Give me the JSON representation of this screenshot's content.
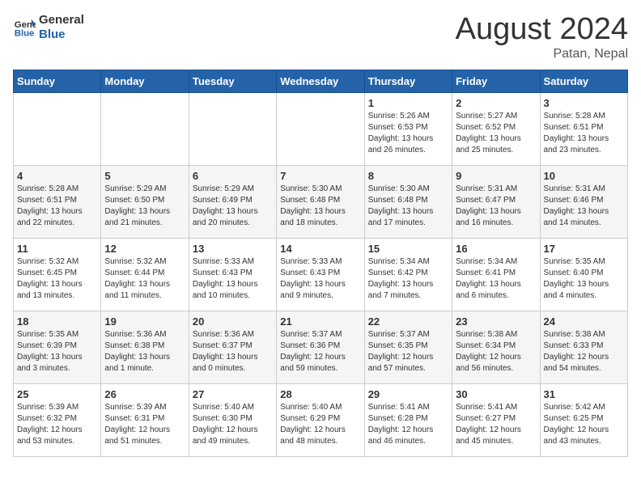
{
  "header": {
    "logo_general": "General",
    "logo_blue": "Blue",
    "main_title": "August 2024",
    "subtitle": "Patan, Nepal"
  },
  "days_of_week": [
    "Sunday",
    "Monday",
    "Tuesday",
    "Wednesday",
    "Thursday",
    "Friday",
    "Saturday"
  ],
  "weeks": [
    [
      {
        "day": "",
        "sunrise": "",
        "sunset": "",
        "daylight": ""
      },
      {
        "day": "",
        "sunrise": "",
        "sunset": "",
        "daylight": ""
      },
      {
        "day": "",
        "sunrise": "",
        "sunset": "",
        "daylight": ""
      },
      {
        "day": "",
        "sunrise": "",
        "sunset": "",
        "daylight": ""
      },
      {
        "day": "1",
        "sunrise": "Sunrise: 5:26 AM",
        "sunset": "Sunset: 6:53 PM",
        "daylight": "Daylight: 13 hours and 26 minutes."
      },
      {
        "day": "2",
        "sunrise": "Sunrise: 5:27 AM",
        "sunset": "Sunset: 6:52 PM",
        "daylight": "Daylight: 13 hours and 25 minutes."
      },
      {
        "day": "3",
        "sunrise": "Sunrise: 5:28 AM",
        "sunset": "Sunset: 6:51 PM",
        "daylight": "Daylight: 13 hours and 23 minutes."
      }
    ],
    [
      {
        "day": "4",
        "sunrise": "Sunrise: 5:28 AM",
        "sunset": "Sunset: 6:51 PM",
        "daylight": "Daylight: 13 hours and 22 minutes."
      },
      {
        "day": "5",
        "sunrise": "Sunrise: 5:29 AM",
        "sunset": "Sunset: 6:50 PM",
        "daylight": "Daylight: 13 hours and 21 minutes."
      },
      {
        "day": "6",
        "sunrise": "Sunrise: 5:29 AM",
        "sunset": "Sunset: 6:49 PM",
        "daylight": "Daylight: 13 hours and 20 minutes."
      },
      {
        "day": "7",
        "sunrise": "Sunrise: 5:30 AM",
        "sunset": "Sunset: 6:48 PM",
        "daylight": "Daylight: 13 hours and 18 minutes."
      },
      {
        "day": "8",
        "sunrise": "Sunrise: 5:30 AM",
        "sunset": "Sunset: 6:48 PM",
        "daylight": "Daylight: 13 hours and 17 minutes."
      },
      {
        "day": "9",
        "sunrise": "Sunrise: 5:31 AM",
        "sunset": "Sunset: 6:47 PM",
        "daylight": "Daylight: 13 hours and 16 minutes."
      },
      {
        "day": "10",
        "sunrise": "Sunrise: 5:31 AM",
        "sunset": "Sunset: 6:46 PM",
        "daylight": "Daylight: 13 hours and 14 minutes."
      }
    ],
    [
      {
        "day": "11",
        "sunrise": "Sunrise: 5:32 AM",
        "sunset": "Sunset: 6:45 PM",
        "daylight": "Daylight: 13 hours and 13 minutes."
      },
      {
        "day": "12",
        "sunrise": "Sunrise: 5:32 AM",
        "sunset": "Sunset: 6:44 PM",
        "daylight": "Daylight: 13 hours and 11 minutes."
      },
      {
        "day": "13",
        "sunrise": "Sunrise: 5:33 AM",
        "sunset": "Sunset: 6:43 PM",
        "daylight": "Daylight: 13 hours and 10 minutes."
      },
      {
        "day": "14",
        "sunrise": "Sunrise: 5:33 AM",
        "sunset": "Sunset: 6:43 PM",
        "daylight": "Daylight: 13 hours and 9 minutes."
      },
      {
        "day": "15",
        "sunrise": "Sunrise: 5:34 AM",
        "sunset": "Sunset: 6:42 PM",
        "daylight": "Daylight: 13 hours and 7 minutes."
      },
      {
        "day": "16",
        "sunrise": "Sunrise: 5:34 AM",
        "sunset": "Sunset: 6:41 PM",
        "daylight": "Daylight: 13 hours and 6 minutes."
      },
      {
        "day": "17",
        "sunrise": "Sunrise: 5:35 AM",
        "sunset": "Sunset: 6:40 PM",
        "daylight": "Daylight: 13 hours and 4 minutes."
      }
    ],
    [
      {
        "day": "18",
        "sunrise": "Sunrise: 5:35 AM",
        "sunset": "Sunset: 6:39 PM",
        "daylight": "Daylight: 13 hours and 3 minutes."
      },
      {
        "day": "19",
        "sunrise": "Sunrise: 5:36 AM",
        "sunset": "Sunset: 6:38 PM",
        "daylight": "Daylight: 13 hours and 1 minute."
      },
      {
        "day": "20",
        "sunrise": "Sunrise: 5:36 AM",
        "sunset": "Sunset: 6:37 PM",
        "daylight": "Daylight: 13 hours and 0 minutes."
      },
      {
        "day": "21",
        "sunrise": "Sunrise: 5:37 AM",
        "sunset": "Sunset: 6:36 PM",
        "daylight": "Daylight: 12 hours and 59 minutes."
      },
      {
        "day": "22",
        "sunrise": "Sunrise: 5:37 AM",
        "sunset": "Sunset: 6:35 PM",
        "daylight": "Daylight: 12 hours and 57 minutes."
      },
      {
        "day": "23",
        "sunrise": "Sunrise: 5:38 AM",
        "sunset": "Sunset: 6:34 PM",
        "daylight": "Daylight: 12 hours and 56 minutes."
      },
      {
        "day": "24",
        "sunrise": "Sunrise: 5:38 AM",
        "sunset": "Sunset: 6:33 PM",
        "daylight": "Daylight: 12 hours and 54 minutes."
      }
    ],
    [
      {
        "day": "25",
        "sunrise": "Sunrise: 5:39 AM",
        "sunset": "Sunset: 6:32 PM",
        "daylight": "Daylight: 12 hours and 53 minutes."
      },
      {
        "day": "26",
        "sunrise": "Sunrise: 5:39 AM",
        "sunset": "Sunset: 6:31 PM",
        "daylight": "Daylight: 12 hours and 51 minutes."
      },
      {
        "day": "27",
        "sunrise": "Sunrise: 5:40 AM",
        "sunset": "Sunset: 6:30 PM",
        "daylight": "Daylight: 12 hours and 49 minutes."
      },
      {
        "day": "28",
        "sunrise": "Sunrise: 5:40 AM",
        "sunset": "Sunset: 6:29 PM",
        "daylight": "Daylight: 12 hours and 48 minutes."
      },
      {
        "day": "29",
        "sunrise": "Sunrise: 5:41 AM",
        "sunset": "Sunset: 6:28 PM",
        "daylight": "Daylight: 12 hours and 46 minutes."
      },
      {
        "day": "30",
        "sunrise": "Sunrise: 5:41 AM",
        "sunset": "Sunset: 6:27 PM",
        "daylight": "Daylight: 12 hours and 45 minutes."
      },
      {
        "day": "31",
        "sunrise": "Sunrise: 5:42 AM",
        "sunset": "Sunset: 6:25 PM",
        "daylight": "Daylight: 12 hours and 43 minutes."
      }
    ]
  ]
}
